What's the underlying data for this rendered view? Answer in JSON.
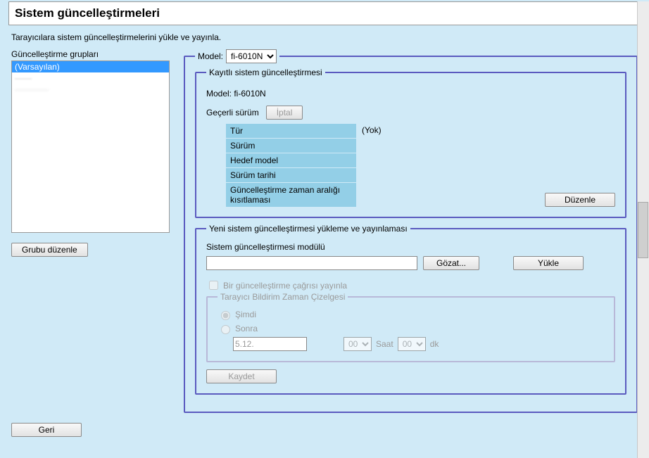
{
  "title": "Sistem güncelleştirmeleri",
  "subtitle": "Tarayıcılara sistem güncelleştirmelerini yükle ve yayınla.",
  "groups": {
    "label": "Güncelleştirme grupları",
    "items": [
      "(Varsayılan)",
      "——",
      "————"
    ],
    "edit_btn": "Grubu düzenle"
  },
  "model": {
    "label": "Model:",
    "value": "fi-6010N",
    "options": [
      "fi-6010N"
    ]
  },
  "registered": {
    "legend": "Kayıtlı sistem güncelleştirmesi",
    "model_label": "Model: fi-6010N",
    "current_version_label": "Geçerli sürüm",
    "cancel_btn": "İptal",
    "none": "(Yok)",
    "props": [
      "Tür",
      "Sürüm",
      "Hedef model",
      "Sürüm tarihi",
      "Güncelleştirme zaman aralığı kısıtlaması"
    ],
    "edit_btn": "Düzenle"
  },
  "upload": {
    "legend": "Yeni sistem güncelleştirmesi yükleme ve yayınlaması",
    "module_label": "Sistem güncelleştirmesi modülü",
    "browse_btn": "Gözat...",
    "load_btn": "Yükle",
    "publish_call": "Bir güncelleştirme çağrısı yayınla",
    "schedule": {
      "legend": "Tarayıcı Bildirim Zaman Çizelgesi",
      "now": "Şimdi",
      "later": "Sonra",
      "date": "5.12.",
      "hour": "00",
      "hour_label": "Saat",
      "min": "00",
      "min_label": "dk"
    },
    "save_btn": "Kaydet"
  },
  "back_btn": "Geri"
}
